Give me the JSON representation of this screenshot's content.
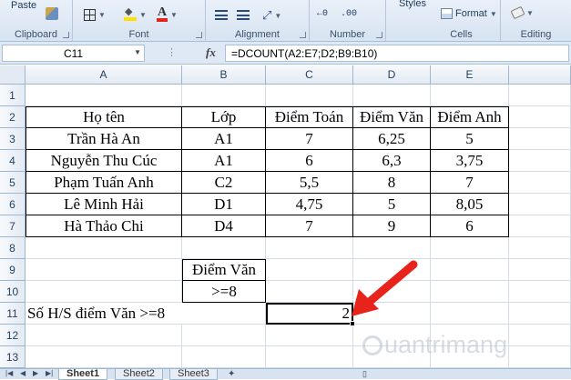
{
  "ribbon": {
    "clipboard": {
      "paste_label": "Paste",
      "group_label": "Clipboard"
    },
    "font": {
      "group_label": "Font"
    },
    "alignment": {
      "group_label": "Alignment"
    },
    "number": {
      "group_label": "Number",
      "decimals_more": "+.0 .00",
      "decimals_less": ".00 →.0"
    },
    "cells": {
      "format_label": "Format",
      "group_label": "Cells",
      "styles_label": "Styles"
    },
    "editing": {
      "group_label": "Editing"
    }
  },
  "formula_bar": {
    "name_box": "C11",
    "fx": "fx",
    "formula": "=DCOUNT(A2:E7;D2;B9:B10)"
  },
  "columns": [
    "A",
    "B",
    "C",
    "D",
    "E"
  ],
  "rows": [
    "1",
    "2",
    "3",
    "4",
    "5",
    "6",
    "7",
    "8",
    "9",
    "10",
    "11",
    "12",
    "13"
  ],
  "table": {
    "headers": [
      "Họ tên",
      "Lớp",
      "Điểm Toán",
      "Điểm Văn",
      "Điểm Anh"
    ],
    "records": [
      [
        "Trần Hà An",
        "A1",
        "7",
        "6,25",
        "5"
      ],
      [
        "Nguyễn Thu Cúc",
        "A1",
        "6",
        "6,3",
        "3,75"
      ],
      [
        "Phạm Tuấn Anh",
        "C2",
        "5,5",
        "8",
        "7"
      ],
      [
        "Lê Minh Hải",
        "D1",
        "4,75",
        "5",
        "8,05"
      ],
      [
        "Hà Thảo Chi",
        "D4",
        "7",
        "9",
        "6"
      ]
    ]
  },
  "criteria": {
    "header": "Điểm Văn",
    "value": ">=8"
  },
  "result": {
    "label": "Số H/S điểm Văn >=8",
    "value": "2"
  },
  "watermark": "uantrimang",
  "sheets": [
    "Sheet1",
    "Sheet2",
    "Sheet3"
  ],
  "colors": {
    "arrow": "#e8231c",
    "ribbon_bg": "#dfe8f5"
  }
}
